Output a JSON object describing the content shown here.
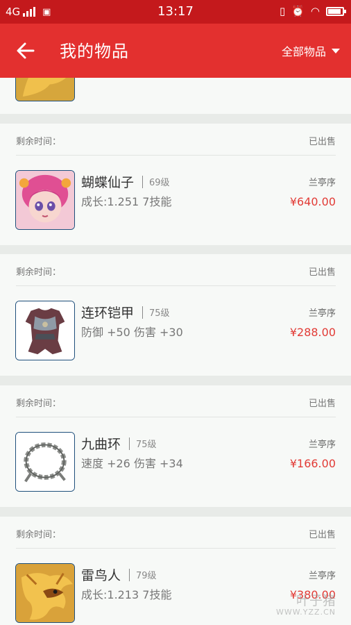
{
  "status_bar": {
    "network": "4G",
    "time": "13:17"
  },
  "header": {
    "title": "我的物品",
    "filter": "全部物品"
  },
  "list": {
    "remain_label": "剩余时间：",
    "items": [
      {
        "status": "已出售",
        "name": "蝴蝶仙子",
        "level": "69级",
        "stats": "成长:1.251  7技能",
        "seller": "兰亭序",
        "price": "¥640.00",
        "icon": "fairy-pet-icon"
      },
      {
        "status": "已出售",
        "name": "连环铠甲",
        "level": "75级",
        "stats": "防御 +50 伤害 +30",
        "seller": "兰亭序",
        "price": "¥288.00",
        "icon": "armor-icon"
      },
      {
        "status": "已出售",
        "name": "九曲环",
        "level": "75级",
        "stats": "速度 +26 伤害 +34",
        "seller": "兰亭序",
        "price": "¥166.00",
        "icon": "chain-ring-icon"
      },
      {
        "status": "已出售",
        "name": "雷鸟人",
        "level": "79级",
        "stats": "成长:1.213  7技能",
        "seller": "兰亭序",
        "price": "¥380.00",
        "icon": "thunderbird-pet-icon"
      }
    ]
  },
  "watermark": {
    "text": "叶子猪",
    "sub": "WWW.YZZ.CN"
  },
  "colors": {
    "status_bar": "#c4191c",
    "app_bar": "#e3302f",
    "price": "#e23b36",
    "thumb_border": "#1e4f7b"
  }
}
